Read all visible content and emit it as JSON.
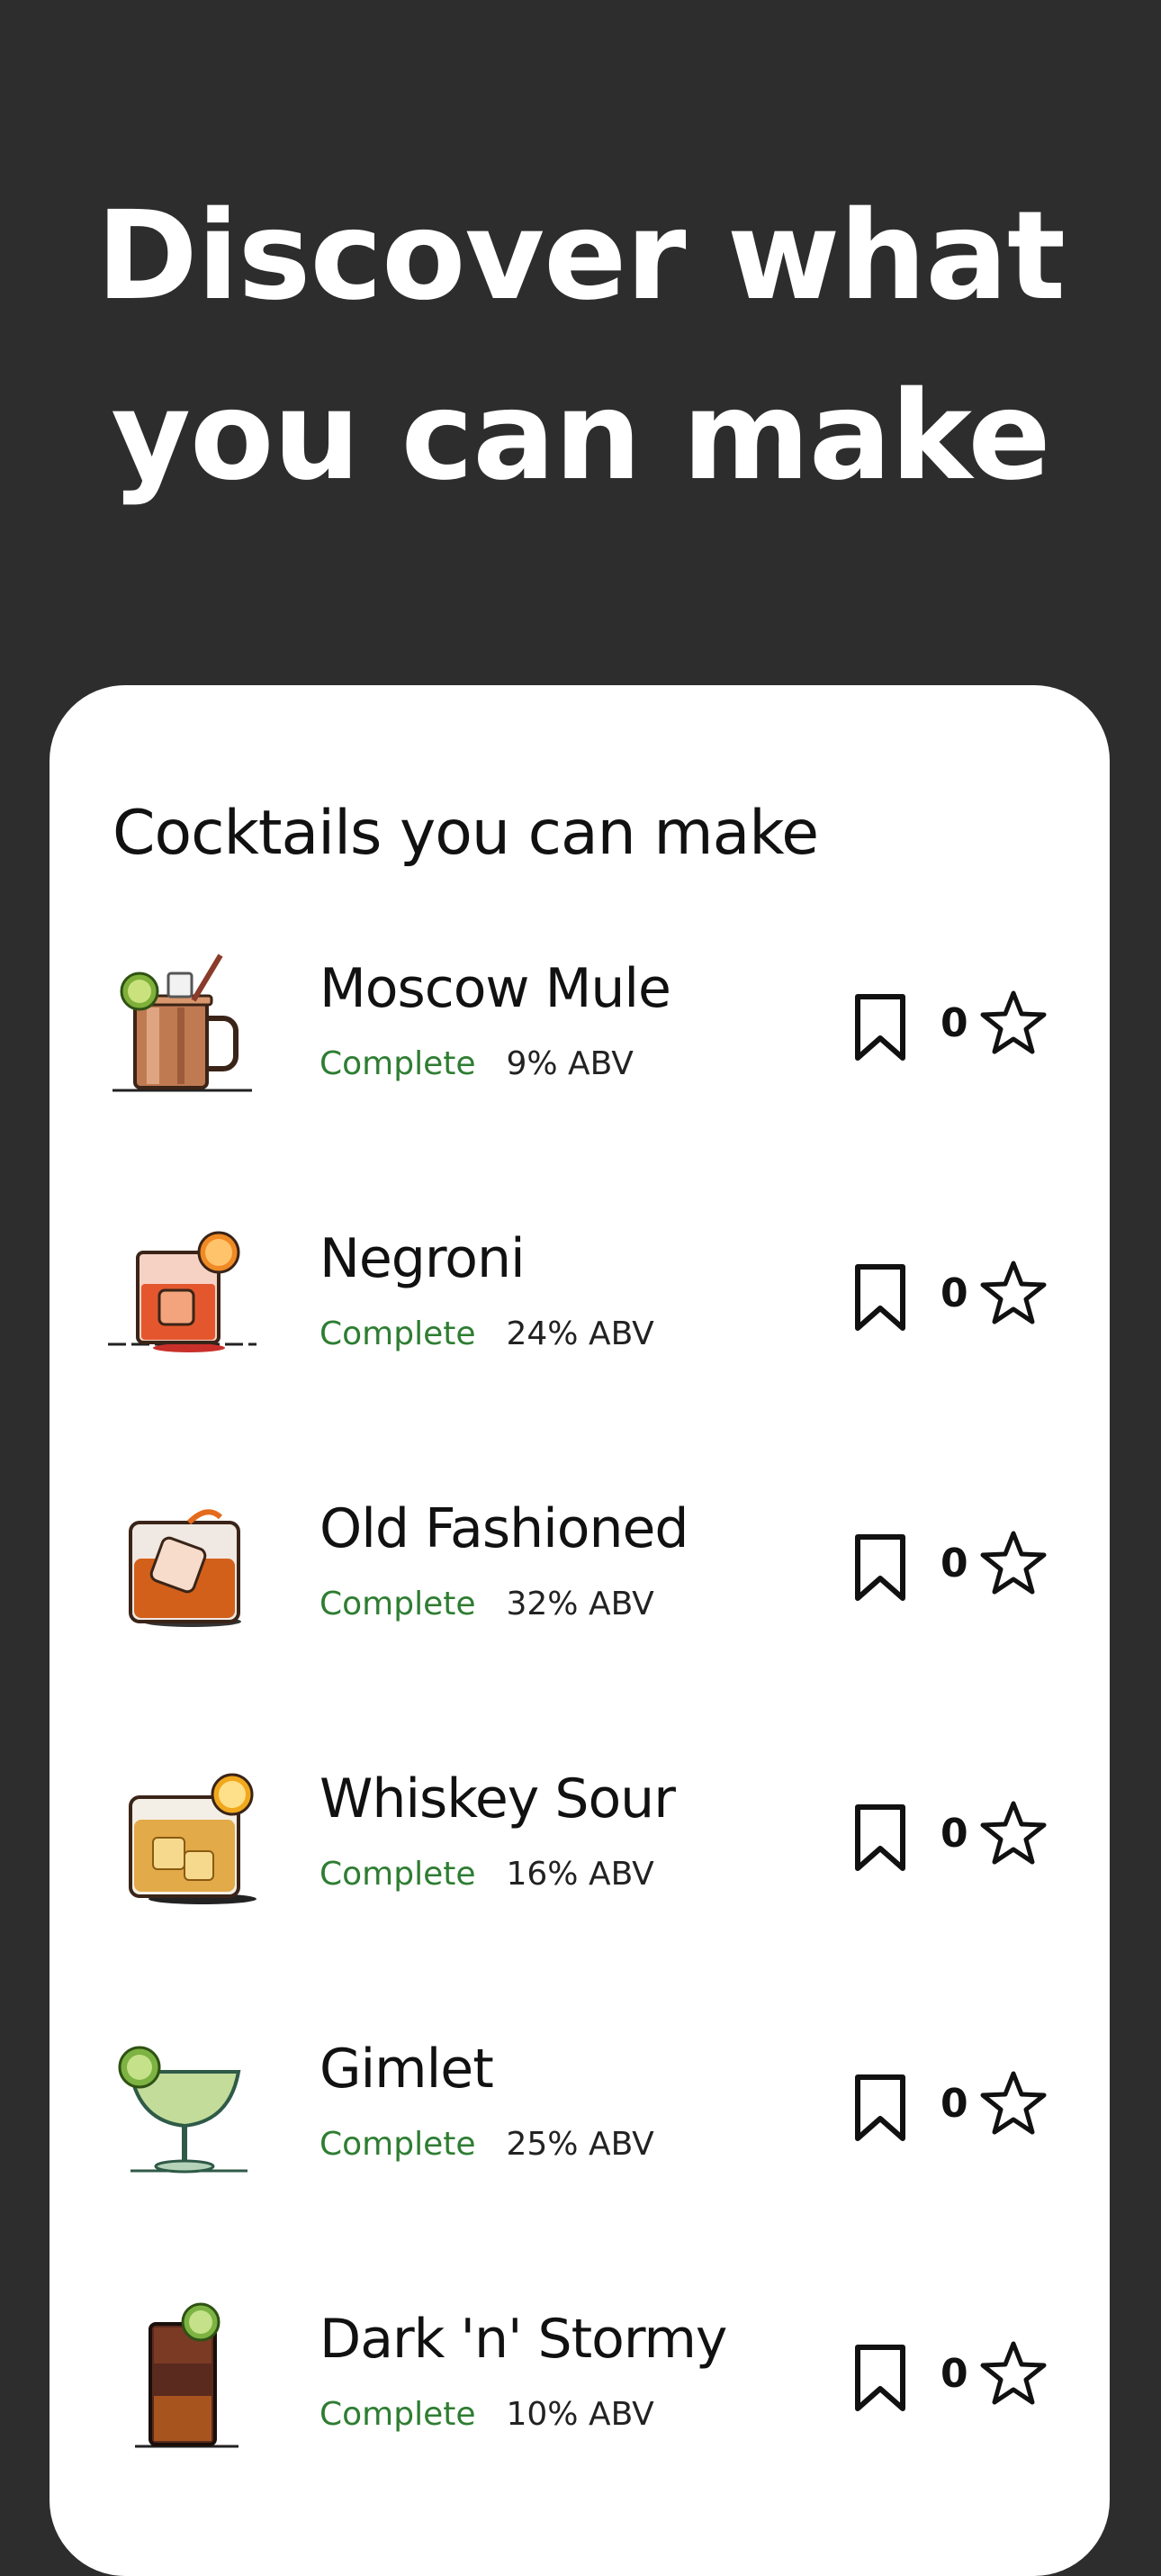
{
  "hero": {
    "line1": "Discover what",
    "line2": "you can make"
  },
  "section_title": "Cocktails you can make",
  "status_color": "#2e7d32",
  "cocktails": [
    {
      "name": "Moscow Mule",
      "status": "Complete",
      "abv": "9% ABV",
      "rating": "0",
      "icon": "moscow-mule-mug-icon"
    },
    {
      "name": "Negroni",
      "status": "Complete",
      "abv": "24% ABV",
      "rating": "0",
      "icon": "negroni-glass-icon"
    },
    {
      "name": "Old Fashioned",
      "status": "Complete",
      "abv": "32% ABV",
      "rating": "0",
      "icon": "old-fashioned-glass-icon"
    },
    {
      "name": "Whiskey Sour",
      "status": "Complete",
      "abv": "16% ABV",
      "rating": "0",
      "icon": "whiskey-sour-glass-icon"
    },
    {
      "name": "Gimlet",
      "status": "Complete",
      "abv": "25% ABV",
      "rating": "0",
      "icon": "gimlet-coupe-icon"
    },
    {
      "name": "Dark 'n' Stormy",
      "status": "Complete",
      "abv": "10% ABV",
      "rating": "0",
      "icon": "dark-n-stormy-highball-icon"
    }
  ]
}
